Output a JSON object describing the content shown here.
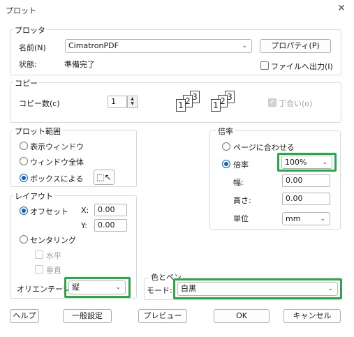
{
  "window": {
    "title": "プロット",
    "close_icon": "close-icon"
  },
  "plotter": {
    "group_label": "プロッタ",
    "name_label": "名前(N)",
    "name_value": "CimatronPDF",
    "properties_button": "プロパティ(P)",
    "status_label": "状態:",
    "status_value": "準備完了",
    "print_to_file_label": "ファイルへ出力(I)"
  },
  "copies": {
    "group_label": "コピー",
    "count_label": "コピー数(c)",
    "count_value": "1",
    "collate_label": "丁合い(o)",
    "collate_icon": "collate-pages-icon",
    "uncollate_icon": "uncollate-pages-icon",
    "page_nums": [
      "1",
      "2",
      "3"
    ]
  },
  "plot_area": {
    "group_label": "プロット範囲",
    "options": [
      {
        "label": "表示ウィンドウ",
        "selected": false
      },
      {
        "label": "ウィンドウ全体",
        "selected": false
      },
      {
        "label": "ボックスによる",
        "selected": true
      }
    ],
    "pick_icon": "cursor-pick-icon"
  },
  "layout": {
    "group_label": "レイアウト",
    "offset_label": "オフセット",
    "x_label": "X:",
    "x_value": "0.00",
    "y_label": "Y:",
    "y_value": "0.00",
    "centering_label": "センタリング",
    "horizontal_label": "水平",
    "vertical_label": "垂直",
    "orientation_label": "オリエンテーション",
    "orientation_value": "縦"
  },
  "scale": {
    "group_label": "倍率",
    "fit_page_label": "ページに合わせる",
    "scale_label": "倍率",
    "scale_value": "100%",
    "width_label": "幅:",
    "width_value": "0.00",
    "height_label": "高さ:",
    "height_value": "0.00",
    "unit_label": "単位",
    "unit_value": "mm"
  },
  "color": {
    "group_label": "色とペン",
    "mode_label": "モード:",
    "mode_value": "白黒"
  },
  "buttons": {
    "help": "ヘルプ",
    "general": "一般設定",
    "preview": "プレビュー",
    "ok": "OK",
    "cancel": "キャンセル"
  },
  "accent_colors": {
    "highlight": "#2ba84a",
    "radio_selected": "#0a62c9"
  }
}
